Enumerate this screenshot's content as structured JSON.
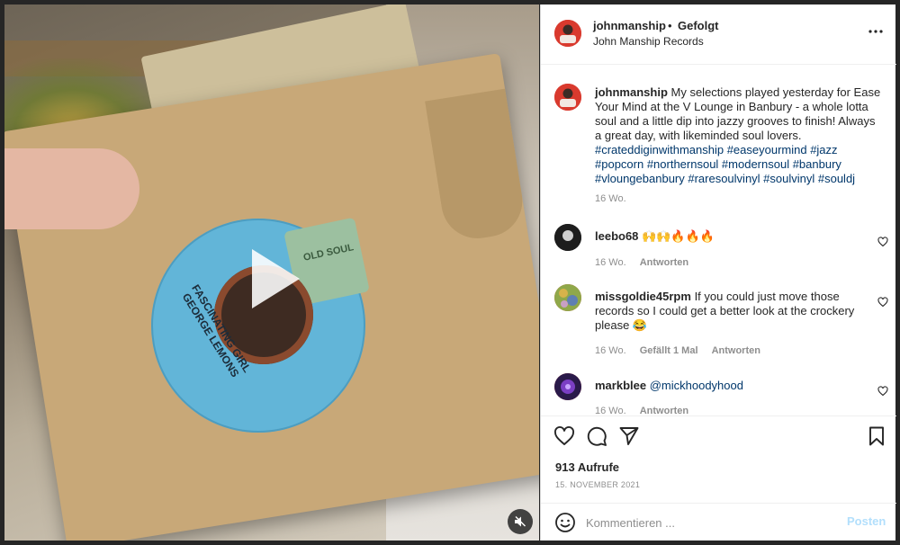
{
  "post": {
    "username": "johnmanship",
    "separator": "•",
    "follow_status": "Gefolgt",
    "location": "John Manship Records"
  },
  "media": {
    "record_title": "FASCINATING GIRL",
    "record_artist": "GEORGE LEMONS",
    "record_label": "OLD SOUL",
    "play_icon": "play-icon",
    "mute_icon": "speaker-muted-icon"
  },
  "caption": {
    "username": "johnmanship",
    "text": "My selections played yesterday for Ease Your Mind at the V Lounge in Banbury - a whole lotta soul and a little dip into jazzy grooves to finish! Always a great day, with likeminded soul lovers.",
    "hashtags": "#crateddiginwithmanship #easeyourmind #jazz #popcorn #northernsoul #modernsoul #banbury #vloungebanbury #raresoulvinyl #soulvinyl #souldj",
    "age": "16 Wo."
  },
  "comments": [
    {
      "username": "leebo68",
      "text": "🙌🙌🔥🔥🔥",
      "age": "16 Wo.",
      "likes": "",
      "reply": "Antworten"
    },
    {
      "username": "missgoldie45rpm",
      "text": "If you could just move those records so I could get a better look at the crockery please 😂",
      "age": "16 Wo.",
      "likes": "Gefällt 1 Mal",
      "reply": "Antworten"
    },
    {
      "username": "markblee",
      "text": "@mickhoodyhood",
      "age": "16 Wo.",
      "likes": "",
      "reply": "Antworten"
    }
  ],
  "stats": {
    "views": "913 Aufrufe",
    "date": "15. NOVEMBER 2021"
  },
  "composer": {
    "placeholder": "Kommentieren ...",
    "post_label": "Posten"
  },
  "colors": {
    "link": "#00376b",
    "muted": "#8e8e8e",
    "post_disabled": "#b2dffc"
  }
}
